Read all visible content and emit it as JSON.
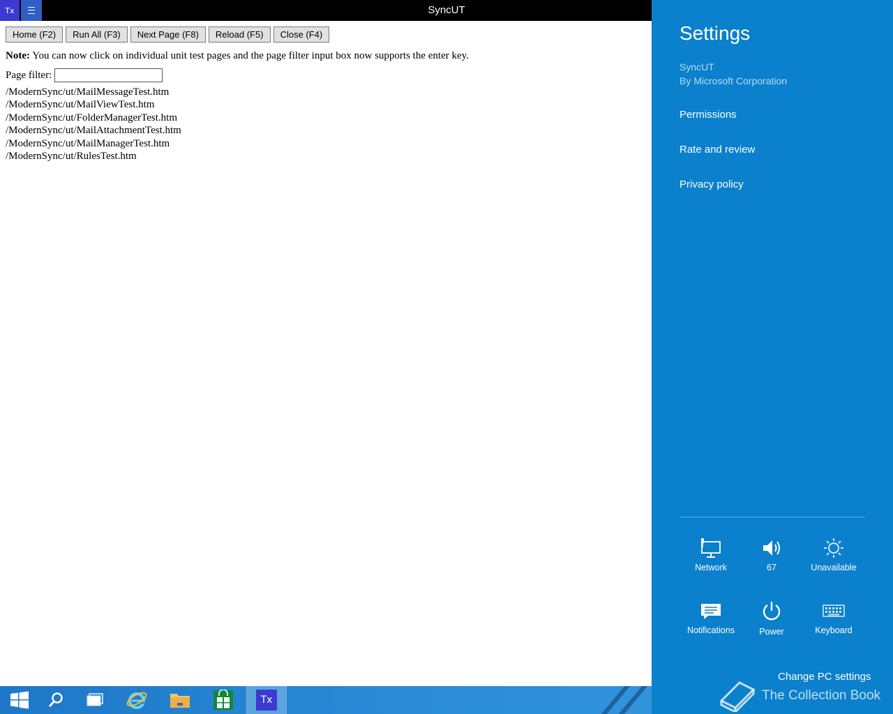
{
  "window": {
    "title": "SyncUT",
    "app_icon": "Tx"
  },
  "toolbar": {
    "home": "Home (F2)",
    "run_all": "Run All (F3)",
    "next_page": "Next Page (F8)",
    "reload": "Reload (F5)",
    "close": "Close (F4)"
  },
  "note": {
    "label": "Note:",
    "text": "You can now click on individual unit test pages and the page filter input box now supports the enter key."
  },
  "filter": {
    "label": "Page filter:",
    "value": ""
  },
  "tests": [
    "/ModernSync/ut/MailMessageTest.htm",
    "/ModernSync/ut/MailViewTest.htm",
    "/ModernSync/ut/FolderManagerTest.htm",
    "/ModernSync/ut/MailAttachmentTest.htm",
    "/ModernSync/ut/MailManagerTest.htm",
    "/ModernSync/ut/RulesTest.htm"
  ],
  "taskbar": {
    "items": [
      "start-icon",
      "search-icon",
      "task-view-icon",
      "internet-explorer-icon",
      "file-explorer-icon",
      "store-icon",
      "syncut-app-icon"
    ],
    "active_label": "Tx"
  },
  "settings": {
    "title": "Settings",
    "app_name": "SyncUT",
    "publisher": "By Microsoft Corporation",
    "links": [
      "Permissions",
      "Rate and review",
      "Privacy policy"
    ],
    "tiles": [
      {
        "icon": "network-icon",
        "label": "Network"
      },
      {
        "icon": "volume-icon",
        "label": "67"
      },
      {
        "icon": "brightness-icon",
        "label": "Unavailable"
      },
      {
        "icon": "notifications-icon",
        "label": "Notifications"
      },
      {
        "icon": "power-icon",
        "label": "Power"
      },
      {
        "icon": "keyboard-icon",
        "label": "Keyboard"
      }
    ],
    "change_pc_settings": "Change PC settings",
    "watermark": "The Collection Book"
  },
  "colors": {
    "charm_bg": "#0b80cc",
    "titlebar_bg": "#000000",
    "taskbar_bg": "#2a8ad6"
  }
}
